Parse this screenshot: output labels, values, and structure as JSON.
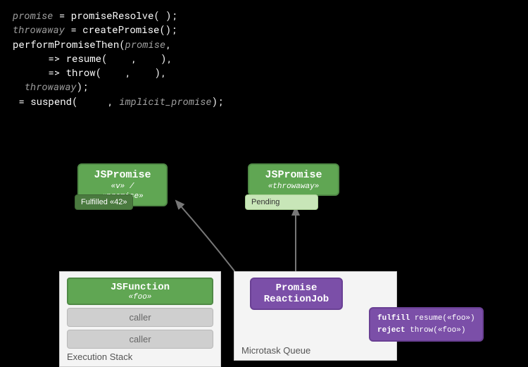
{
  "code": {
    "line1_var": "promise",
    "line1_assign": " = ",
    "line1_fn": "promiseResolve",
    "line1_rest": "( );",
    "line2_var": "throwaway",
    "line2_assign": " = ",
    "line2_fn": "createPromise",
    "line2_rest": "();",
    "line3_fn": "performPromiseThen",
    "line3_open": "(",
    "line3_arg": "promise",
    "line3_close": ",",
    "line4_indent": "      ",
    "line4_arrow": "=> ",
    "line4_fn": "resume",
    "line4_rest": "(    ,    ),",
    "line5_indent": "      ",
    "line5_arrow": "=> ",
    "line5_fn": "throw",
    "line5_rest": "(    ,    ),",
    "line6_indent": "  ",
    "line6_var": "throwaway",
    "line6_rest": ");",
    "line7_eq": " = ",
    "line7_fn": "suspend",
    "line7_open": "(     , ",
    "line7_arg": "implicit_promise",
    "line7_rest": ");"
  },
  "promise1": {
    "title": "JSPromise",
    "subtitle": "«v» / «promise»",
    "state": "Fulfilled «42»"
  },
  "promise2": {
    "title": "JSPromise",
    "subtitle": "«throwaway»",
    "state": "Pending"
  },
  "exec_stack": {
    "top_title": "JSFunction",
    "top_sub": "«foo»",
    "frame1": "caller",
    "frame2": "caller",
    "label": "Execution Stack"
  },
  "microtask_queue": {
    "job_line1": "Promise",
    "job_line2": "ReactionJob",
    "label": "Microtask Queue"
  },
  "detail": {
    "fulfill_label": "fulfill",
    "fulfill_fn": " resume(«foo»)",
    "reject_label": "reject",
    "reject_fn": "  throw(«foo»)"
  }
}
